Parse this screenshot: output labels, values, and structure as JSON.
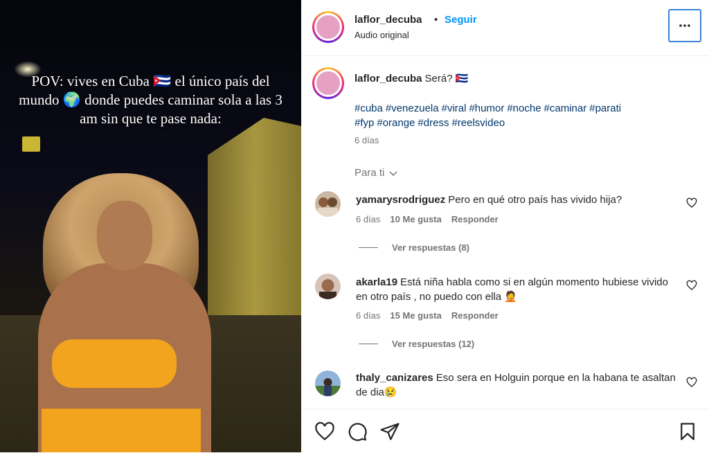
{
  "video": {
    "overlay_text": "POV: vives en Cuba 🇨🇺 el único país del mundo 🌍 donde puedes caminar sola a las 3 am sin que te pase nada:"
  },
  "header": {
    "username": "laflor_decuba",
    "separator": "•",
    "follow_label": "Seguir",
    "audio_label": "Audio original",
    "more_icon": "more-horizontal-icon"
  },
  "post": {
    "username": "laflor_decuba",
    "caption": "Será? 🇨🇺",
    "hashtags": [
      "#cuba",
      "#venezuela",
      "#viral",
      "#humor",
      "#noche",
      "#caminar",
      "#parati",
      "#fyp",
      "#orange",
      "#dress",
      "#reelsvideo"
    ],
    "age": "6 días"
  },
  "filter": {
    "label": "Para ti"
  },
  "comments": [
    {
      "username": "yamarysrodriguez",
      "text": "Pero en qué otro país has vivido hija?",
      "age": "6 días",
      "likes": "10 Me gusta",
      "reply_label": "Responder",
      "view_replies": "Ver respuestas (8)"
    },
    {
      "username": "akarla19",
      "text": "Está niña habla como si en algún momento hubiese vivido en otro país , no puedo con ella 🤦",
      "age": "6 días",
      "likes": "15 Me gusta",
      "reply_label": "Responder",
      "view_replies": "Ver respuestas (12)"
    },
    {
      "username": "thaly_canizares",
      "text": "Eso sera en Holguin porque en la habana te asaltan de dia😢"
    }
  ],
  "colors": {
    "accent": "#0095f6",
    "hashtag": "#00376b",
    "muted": "#737373"
  }
}
